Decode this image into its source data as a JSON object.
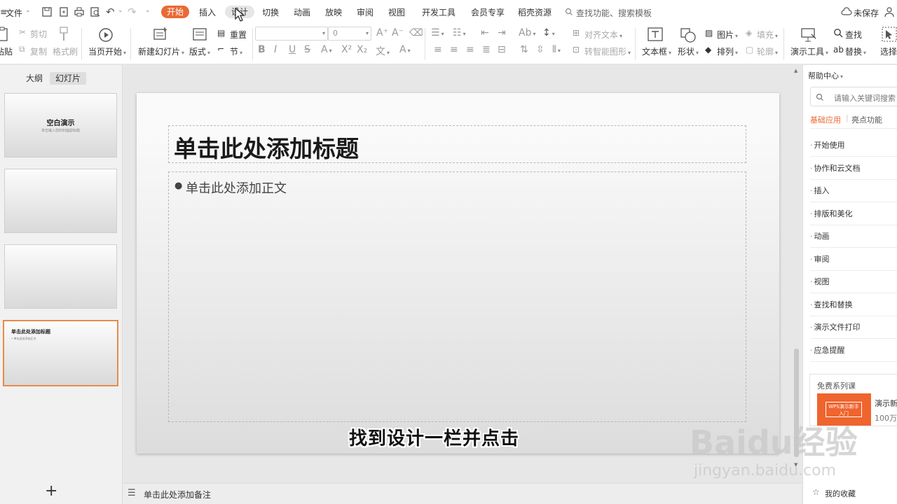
{
  "menubar": {
    "file": "文件",
    "tabs": [
      "开始",
      "插入",
      "设计",
      "切换",
      "动画",
      "放映",
      "审阅",
      "视图",
      "开发工具",
      "会员专享",
      "稻壳资源"
    ],
    "search": "查找功能、搜索模板",
    "unsaved": "未保存"
  },
  "ribbon": {
    "paste": "粘贴",
    "cut": "剪切",
    "copy": "复制",
    "format_painter": "格式刷",
    "from_current": "当页开始",
    "new_slide": "新建幻灯片",
    "layout": "版式",
    "reset": "重置",
    "section": "节",
    "font_size": "0",
    "align_text": "对齐文本",
    "smartart": "转智能图形",
    "textbox": "文本框",
    "shape": "形状",
    "picture": "图片",
    "fill": "填充",
    "arrange": "排列",
    "outline": "轮廓",
    "presenter_tools": "演示工具",
    "find": "查找",
    "replace": "替换",
    "select": "选择"
  },
  "leftpane": {
    "tab_outline": "大纲",
    "tab_slides": "幻灯片",
    "thumb1_title": "空白演示",
    "thumb1_sub": "单击输入您的封面副标题",
    "thumb4_title": "单击此处添加标题",
    "thumb4_body": "• 单击此处添加正文"
  },
  "slide": {
    "title_placeholder": "单击此处添加标题",
    "body_placeholder": "单击此处添加正文"
  },
  "notes": {
    "placeholder": "单击此处添加备注"
  },
  "helppane": {
    "header": "帮助中心",
    "search_placeholder": "请输入关键词搜索",
    "tab_basic": "基础应用",
    "tab_fun": "亮点功能",
    "items": [
      "开始使用",
      "协作和云文档",
      "插入",
      "排版和美化",
      "动画",
      "审阅",
      "视图",
      "查找和替换",
      "演示文件打印",
      "应急提醒"
    ],
    "course_header": "免费系列课",
    "course_badge": "WPS演示新手入门",
    "course_title": "演示新",
    "course_count": "100万",
    "favorites": "我的收藏"
  },
  "overlay": {
    "subtitle": "找到设计一栏并点击",
    "watermark_logo": "Baidu经验",
    "watermark_url": "jingyan.baidu.com"
  },
  "colors": {
    "accent": "#e96a36",
    "thumb_selected": "#e98a4a"
  }
}
